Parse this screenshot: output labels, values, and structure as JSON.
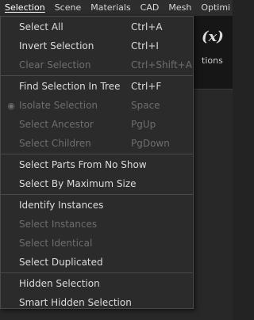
{
  "menubar": {
    "items": [
      {
        "label": "Selection",
        "active": true
      },
      {
        "label": "Scene",
        "active": false
      },
      {
        "label": "Materials",
        "active": false
      },
      {
        "label": "CAD",
        "active": false
      },
      {
        "label": "Mesh",
        "active": false
      },
      {
        "label": "Optimi",
        "active": false
      }
    ]
  },
  "background": {
    "fx_label": "(x)",
    "partial_label": "tions"
  },
  "menu": {
    "groups": [
      [
        {
          "label": "Select All",
          "shortcut": "Ctrl+A",
          "enabled": true
        },
        {
          "label": "Invert Selection",
          "shortcut": "Ctrl+I",
          "enabled": true
        },
        {
          "label": "Clear Selection",
          "shortcut": "Ctrl+Shift+A",
          "enabled": false
        }
      ],
      [
        {
          "label": "Find Selection In Tree",
          "shortcut": "Ctrl+F",
          "enabled": true
        },
        {
          "label": "Isolate Selection",
          "shortcut": "Space",
          "enabled": false,
          "icon": "eye-icon"
        },
        {
          "label": "Select Ancestor",
          "shortcut": "PgUp",
          "enabled": false
        },
        {
          "label": "Select Children",
          "shortcut": "PgDown",
          "enabled": false
        }
      ],
      [
        {
          "label": "Select Parts From No Show",
          "shortcut": "",
          "enabled": true
        },
        {
          "label": "Select By Maximum Size",
          "shortcut": "",
          "enabled": true
        }
      ],
      [
        {
          "label": "Identify Instances",
          "shortcut": "",
          "enabled": true
        },
        {
          "label": "Select Instances",
          "shortcut": "",
          "enabled": false
        },
        {
          "label": "Select Identical",
          "shortcut": "",
          "enabled": false
        },
        {
          "label": "Select Duplicated",
          "shortcut": "",
          "enabled": true
        }
      ],
      [
        {
          "label": "Hidden Selection",
          "shortcut": "",
          "enabled": true
        },
        {
          "label": "Smart Hidden Selection",
          "shortcut": "",
          "enabled": true
        }
      ]
    ]
  },
  "colors": {
    "menu_bg": "#2b2b2b",
    "text_enabled": "#dcdcdc",
    "text_disabled": "#6e6e6e",
    "separator": "#4a4a4a"
  }
}
